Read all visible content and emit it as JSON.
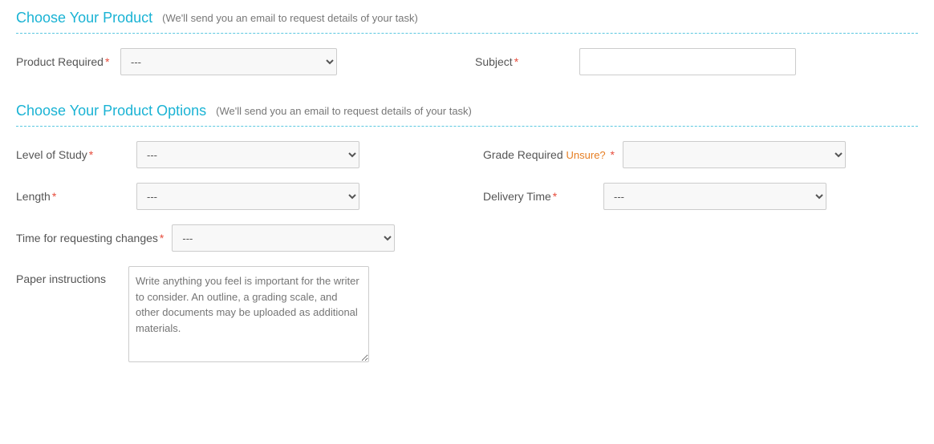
{
  "section1": {
    "title": "Choose Your Product",
    "subtitle": "(We'll send you an email to request details of your task)",
    "product_required_label": "Product Required",
    "product_required_default": "---",
    "subject_label": "Subject",
    "subject_placeholder": "",
    "required_star": "*"
  },
  "section2": {
    "title": "Choose Your Product Options",
    "subtitle": "(We'll send you an email to request details of your task)",
    "level_of_study_label": "Level of Study",
    "level_of_study_default": "---",
    "grade_required_label": "Grade Required",
    "unsure_label": "Unsure?",
    "grade_required_default": "",
    "length_label": "Length",
    "length_default": "---",
    "delivery_time_label": "Delivery Time",
    "delivery_time_default": "---",
    "time_changes_label": "Time for requesting changes",
    "time_changes_default": "---",
    "paper_instructions_label": "Paper instructions",
    "paper_instructions_placeholder": "Write anything you feel is important for the writer to consider. An outline, a grading scale, and other documents may be uploaded as additional materials.",
    "required_star": "*"
  }
}
